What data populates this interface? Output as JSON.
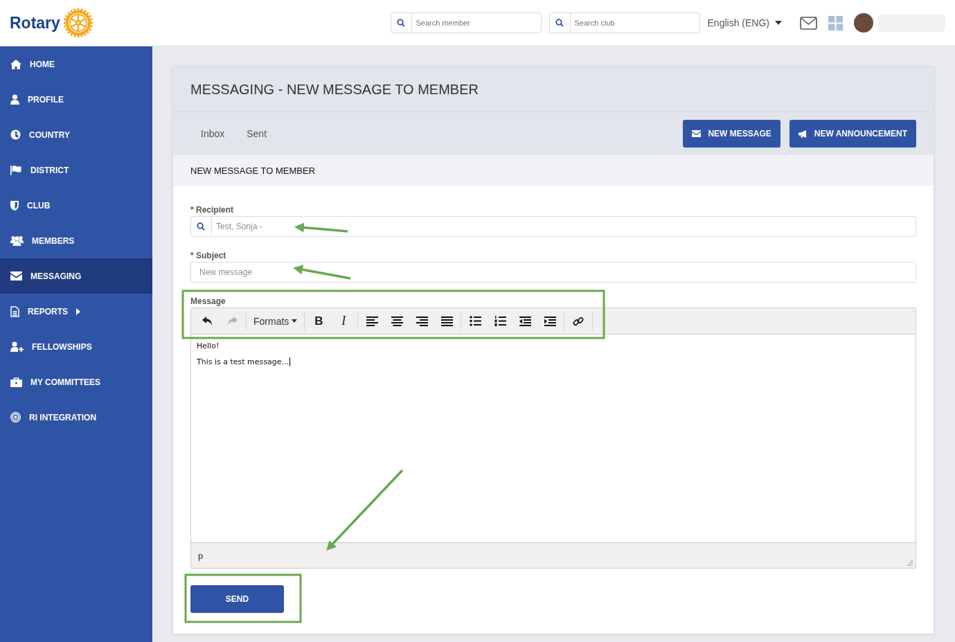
{
  "header": {
    "logo_text": "Rotary",
    "search_member": {
      "placeholder": "Search member"
    },
    "search_club": {
      "placeholder": "Search club"
    },
    "language": "English (ENG)"
  },
  "sidebar": {
    "items": [
      {
        "label": "HOME",
        "selected": false,
        "has_submenu": false
      },
      {
        "label": "PROFILE",
        "selected": false,
        "has_submenu": false
      },
      {
        "label": "COUNTRY",
        "selected": false,
        "has_submenu": false
      },
      {
        "label": "DISTRICT",
        "selected": false,
        "has_submenu": false
      },
      {
        "label": "CLUB",
        "selected": false,
        "has_submenu": false
      },
      {
        "label": "MEMBERS",
        "selected": false,
        "has_submenu": false
      },
      {
        "label": "MESSAGING",
        "selected": true,
        "has_submenu": false
      },
      {
        "label": "REPORTS",
        "selected": false,
        "has_submenu": true
      },
      {
        "label": "FELLOWSHIPS",
        "selected": false,
        "has_submenu": false
      },
      {
        "label": "MY COMMITTEES",
        "selected": false,
        "has_submenu": false
      },
      {
        "label": "RI INTEGRATION",
        "selected": false,
        "has_submenu": false
      }
    ]
  },
  "page": {
    "title": "MESSAGING - NEW MESSAGE TO MEMBER",
    "tabs": [
      {
        "label": "Inbox"
      },
      {
        "label": "Sent"
      }
    ],
    "actions": [
      {
        "label": "NEW MESSAGE",
        "kind": "message"
      },
      {
        "label": "NEW ANNOUNCEMENT",
        "kind": "announcement"
      }
    ],
    "section_title": "NEW MESSAGE TO MEMBER"
  },
  "form": {
    "recipient": {
      "label": "* Recipient",
      "value": "Test, Sonja -"
    },
    "subject": {
      "label": "* Subject",
      "value": "New message"
    },
    "message": {
      "label": "Message",
      "toolbar": [
        [
          {
            "kind": "undo",
            "disabled": false
          },
          {
            "kind": "redo",
            "disabled": true
          }
        ],
        [
          {
            "kind": "formats",
            "label": "Formats",
            "disabled": false
          }
        ],
        [
          {
            "kind": "bold",
            "label": "B",
            "disabled": false
          },
          {
            "kind": "italic",
            "label": "I",
            "disabled": false
          }
        ],
        [
          {
            "kind": "align-left",
            "disabled": false
          },
          {
            "kind": "align-center",
            "disabled": false
          },
          {
            "kind": "align-right",
            "disabled": false
          },
          {
            "kind": "justify",
            "disabled": false
          }
        ],
        [
          {
            "kind": "bullet-list",
            "disabled": false
          },
          {
            "kind": "numbered-list",
            "disabled": false
          },
          {
            "kind": "outdent",
            "disabled": false
          },
          {
            "kind": "indent",
            "disabled": false
          }
        ],
        [
          {
            "kind": "link",
            "disabled": false
          }
        ]
      ],
      "lines": [
        "Hello!",
        "This is a test message..."
      ],
      "status_path": "p"
    },
    "send_button": "SEND"
  }
}
